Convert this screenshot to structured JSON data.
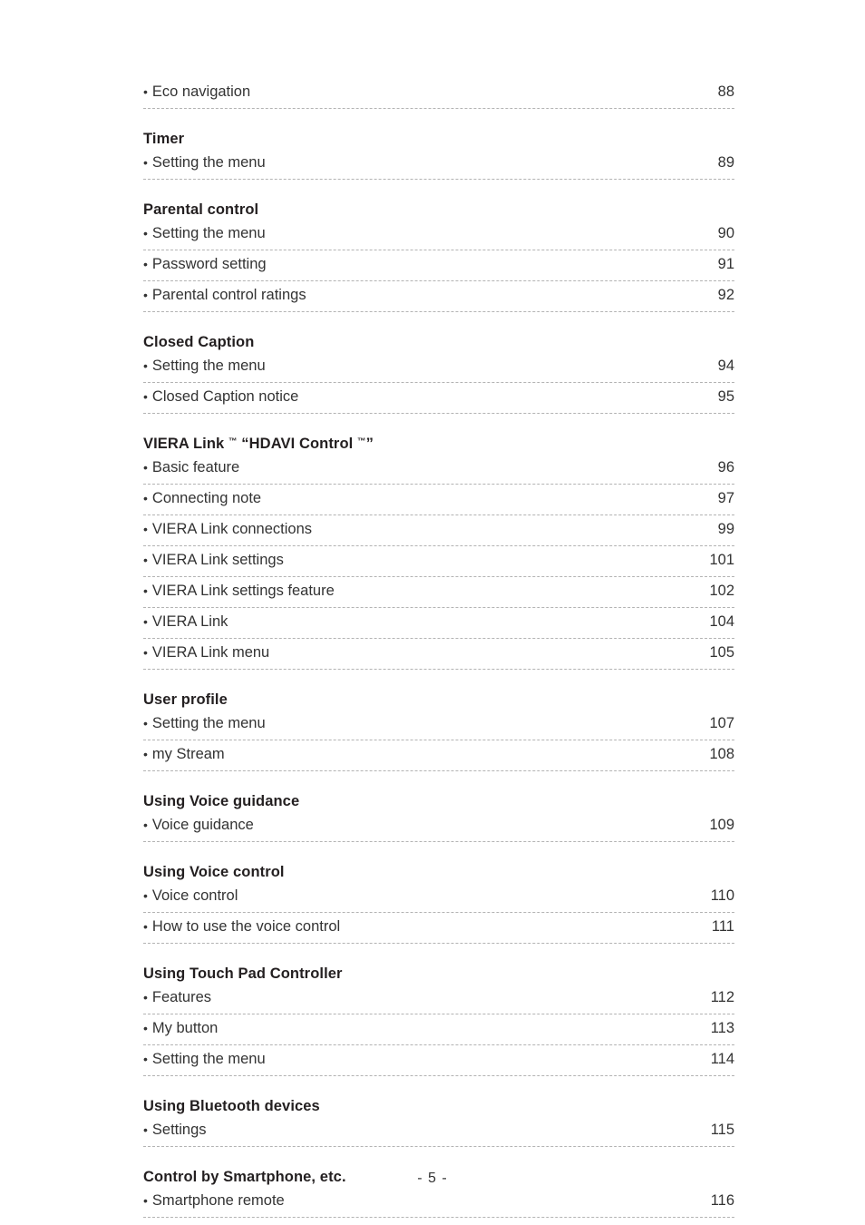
{
  "document": {
    "folio": "- 5 -",
    "bullet_glyph": "•"
  },
  "toc": {
    "groups": [
      {
        "heading": null,
        "entries": [
          {
            "label": "Eco navigation",
            "page": "88"
          }
        ]
      },
      {
        "heading": "Timer",
        "heading_parts": [
          {
            "text": "Timer",
            "sup": false
          }
        ],
        "entries": [
          {
            "label": "Setting the menu",
            "page": "89"
          }
        ]
      },
      {
        "heading": "Parental control",
        "heading_parts": [
          {
            "text": "Parental control",
            "sup": false
          }
        ],
        "entries": [
          {
            "label": "Setting the menu",
            "page": "90"
          },
          {
            "label": "Password setting",
            "page": "91"
          },
          {
            "label": "Parental control ratings",
            "page": "92"
          }
        ]
      },
      {
        "heading": "Closed Caption",
        "heading_parts": [
          {
            "text": "Closed Caption",
            "sup": false
          }
        ],
        "entries": [
          {
            "label": "Setting the menu",
            "page": "94"
          },
          {
            "label": "Closed Caption notice",
            "page": "95"
          }
        ]
      },
      {
        "heading": "VIERA Link ™ “HDAVI Control ™”",
        "heading_parts": [
          {
            "text": "VIERA Link ",
            "sup": false
          },
          {
            "text": "™",
            "sup": true
          },
          {
            "text": " “HDAVI Control ",
            "sup": false
          },
          {
            "text": "™",
            "sup": true
          },
          {
            "text": "”",
            "sup": false
          }
        ],
        "entries": [
          {
            "label": "Basic feature",
            "page": "96"
          },
          {
            "label": "Connecting note",
            "page": "97"
          },
          {
            "label": "VIERA Link connections",
            "page": "99"
          },
          {
            "label": "VIERA Link settings",
            "page": "101"
          },
          {
            "label": "VIERA Link settings feature",
            "page": "102"
          },
          {
            "label": "VIERA Link",
            "page": "104"
          },
          {
            "label": "VIERA Link menu",
            "page": "105"
          }
        ]
      },
      {
        "heading": "User profile",
        "heading_parts": [
          {
            "text": "User profile",
            "sup": false
          }
        ],
        "entries": [
          {
            "label": "Setting the menu",
            "page": "107"
          },
          {
            "label": "my Stream",
            "page": "108"
          }
        ]
      },
      {
        "heading": "Using Voice guidance",
        "heading_parts": [
          {
            "text": "Using Voice guidance",
            "sup": false
          }
        ],
        "entries": [
          {
            "label": "Voice guidance",
            "page": "109"
          }
        ]
      },
      {
        "heading": "Using Voice control",
        "heading_parts": [
          {
            "text": "Using Voice control",
            "sup": false
          }
        ],
        "entries": [
          {
            "label": "Voice control",
            "page": "110"
          },
          {
            "label": "How to use the voice control",
            "page": "111"
          }
        ]
      },
      {
        "heading": "Using Touch Pad Controller",
        "heading_parts": [
          {
            "text": "Using Touch Pad Controller",
            "sup": false
          }
        ],
        "entries": [
          {
            "label": "Features",
            "page": "112"
          },
          {
            "label": "My button",
            "page": "113"
          },
          {
            "label": "Setting the menu",
            "page": "114"
          }
        ]
      },
      {
        "heading": "Using Bluetooth devices",
        "heading_parts": [
          {
            "text": "Using Bluetooth devices",
            "sup": false
          }
        ],
        "entries": [
          {
            "label": "Settings",
            "page": "115"
          }
        ]
      },
      {
        "heading": "Control by Smartphone, etc.",
        "heading_parts": [
          {
            "text": "Control by Smartphone, etc.",
            "sup": false
          }
        ],
        "entries": [
          {
            "label": "Smartphone remote",
            "page": "116"
          }
        ]
      }
    ]
  }
}
